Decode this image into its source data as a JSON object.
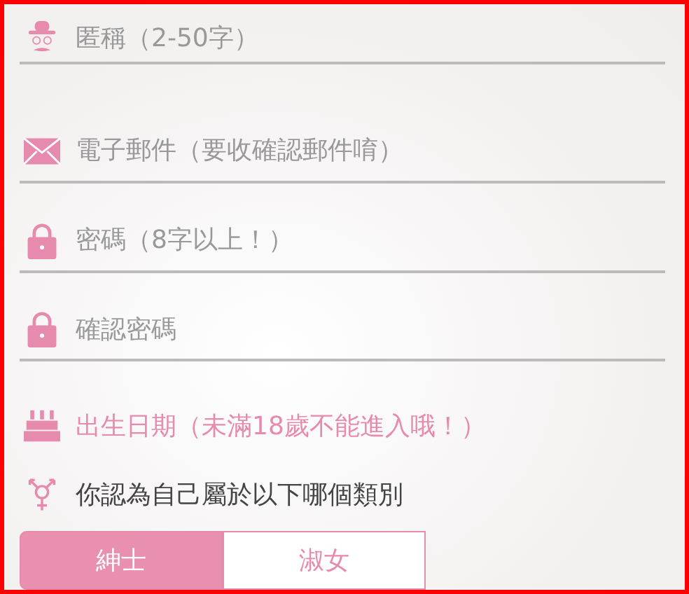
{
  "fields": [
    {
      "kind": "text",
      "placeholder": "匿稱（2-50字）"
    },
    {
      "kind": "text",
      "placeholder": "電子郵件（要收確認郵件唷）"
    },
    {
      "kind": "text",
      "placeholder": "密碼（8字以上！）"
    },
    {
      "kind": "text",
      "placeholder": "確認密碼"
    },
    {
      "kind": "date",
      "label": "出生日期（未滿18歲不能進入哦！）"
    }
  ],
  "gender": {
    "question": "你認為自己屬於以下哪個類別",
    "options": [
      {
        "label": "紳士",
        "selected": true
      },
      {
        "label": "淑女",
        "selected": false
      }
    ]
  }
}
